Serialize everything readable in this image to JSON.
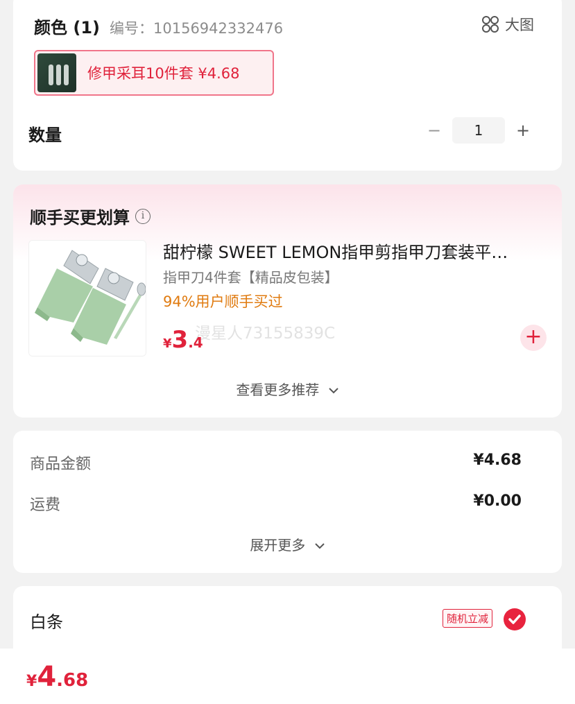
{
  "variant": {
    "title": "颜色 (1)",
    "code": "编号：10156942332476",
    "bigview_label": "大图",
    "selected_chip": "修甲采耳10件套  ¥4.68"
  },
  "quantity": {
    "label": "数量",
    "minus": "−",
    "value": "1",
    "plus": "+"
  },
  "recommend": {
    "title": "顺手买更划算",
    "info": "i",
    "product_name": "甜柠檬  SWEET LEMON指甲剪指甲刀套装平…",
    "spec": "指甲刀4件套【精品皮包装】",
    "stat": "94%用户顺手买过",
    "price_currency": "¥",
    "price_int": "3",
    "price_dec": ".4",
    "watermark": "漫星人73155839C",
    "add": "+",
    "more": "查看更多推荐"
  },
  "summary": {
    "rows": [
      {
        "label": "商品金额",
        "value": "¥4.68"
      },
      {
        "label": "运费",
        "value": "¥0.00"
      }
    ],
    "expand": "展开更多"
  },
  "payment": {
    "label": "白条",
    "promo_tag": "随机立减",
    "selected": true
  },
  "bottom": {
    "currency": "¥",
    "int": "4",
    "dec": ".68"
  },
  "colors": {
    "accent": "#e0223b",
    "orange": "#e07b10",
    "background": "#f2f2f2"
  }
}
